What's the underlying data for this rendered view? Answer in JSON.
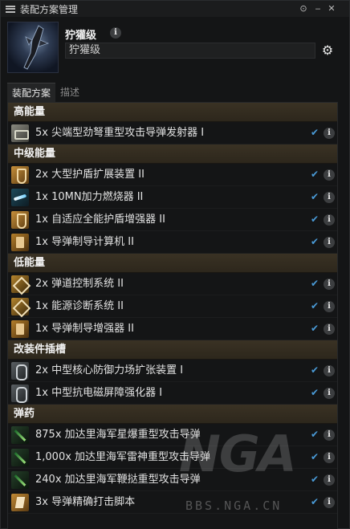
{
  "window": {
    "title": "装配方案管理",
    "controls": {
      "help": "⊙",
      "minimize": "‒",
      "close": "✕"
    }
  },
  "header": {
    "ship_name": "狞獾级",
    "fitting_name_value": "狞獾级",
    "info_label": "i",
    "gear_label": "⚙"
  },
  "tabs": [
    {
      "label": "装配方案",
      "active": true
    },
    {
      "label": "描述",
      "active": false
    }
  ],
  "sections": [
    {
      "title": "高能量",
      "items": [
        {
          "label": "5x 尖端型劲弩重型攻击导弹发射器 I",
          "icon": "launcher-icon"
        }
      ]
    },
    {
      "title": "中级能量",
      "items": [
        {
          "label": "2x 大型护盾扩展装置 II",
          "icon": "shield-extender-icon"
        },
        {
          "label": "1x 10MN加力燃烧器 II",
          "icon": "afterburner-icon"
        },
        {
          "label": "1x 自适应全能护盾增强器 II",
          "icon": "shield-hardener-icon"
        },
        {
          "label": "1x 导弹制导计算机 II",
          "icon": "guidance-computer-icon"
        }
      ]
    },
    {
      "title": "低能量",
      "items": [
        {
          "label": "2x 弹道控制系统 II",
          "icon": "ballistic-control-icon"
        },
        {
          "label": "1x 能源诊断系统 II",
          "icon": "power-diagnostic-icon"
        },
        {
          "label": "1x 导弹制导增强器 II",
          "icon": "guidance-enhancer-icon"
        }
      ]
    },
    {
      "title": "改装件插槽",
      "items": [
        {
          "label": "2x 中型核心防御力场扩张装置 I",
          "icon": "rig-icon"
        },
        {
          "label": "1x 中型抗电磁屏障强化器 I",
          "icon": "rig-icon"
        }
      ]
    },
    {
      "title": "弹药",
      "items": [
        {
          "label": "875x 加达里海军星爆重型攻击导弹",
          "icon": "missile-icon"
        },
        {
          "label": "1,000x 加达里海军雷神重型攻击导弹",
          "icon": "missile-icon"
        },
        {
          "label": "240x 加达里海军鞭挞重型攻击导弹",
          "icon": "missile-icon"
        },
        {
          "label": "3x 导弹精确打击脚本",
          "icon": "script-icon"
        }
      ]
    }
  ],
  "row_marks": {
    "check": "✔",
    "info": "i"
  },
  "watermark": {
    "logo": "NGA",
    "url": "BBS.NGA.CN"
  },
  "colors": {
    "section_bg": "#3a3224",
    "check": "#4a9bd8",
    "window_bg": "#141516"
  }
}
